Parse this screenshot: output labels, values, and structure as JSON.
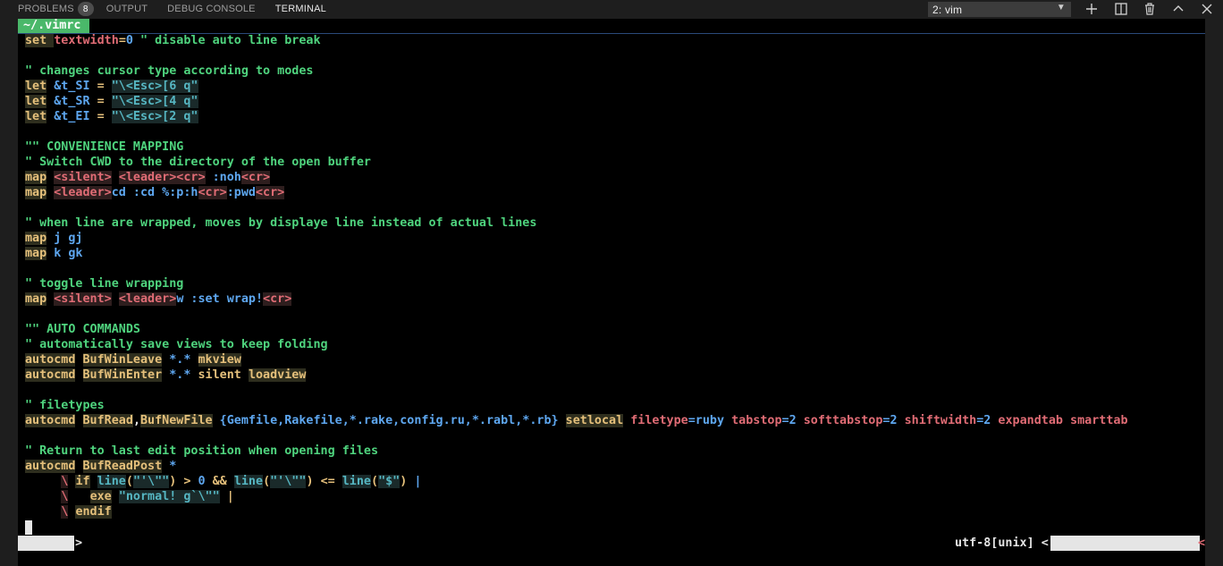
{
  "panel": {
    "tabs": [
      {
        "label": "PROBLEMS",
        "badge": "8"
      },
      {
        "label": "OUTPUT"
      },
      {
        "label": "DEBUG CONSOLE"
      },
      {
        "label": "TERMINAL",
        "active": true
      }
    ],
    "terminal_selector": {
      "value": "2: vim"
    },
    "actions": [
      "plus-icon",
      "split-terminal-icon",
      "trash-icon",
      "chevron-up-icon",
      "close-icon"
    ]
  },
  "vim": {
    "tab_label": "~/.vimrc",
    "lines": [
      [
        {
          "t": "set ",
          "c": "kw"
        },
        {
          "t": "textwidth",
          "c": "var"
        },
        {
          "t": "=",
          "c": "op"
        },
        {
          "t": "0",
          "c": "num"
        },
        {
          "t": " \" disable auto line break",
          "c": "cm"
        }
      ],
      [],
      [
        {
          "t": "\" changes cursor type according to modes",
          "c": "cm"
        }
      ],
      [
        {
          "t": "let",
          "c": "kw"
        },
        {
          "t": " ",
          "c": ""
        },
        {
          "t": "&t_SI",
          "c": "opt"
        },
        {
          "t": " ",
          "c": ""
        },
        {
          "t": "=",
          "c": "op"
        },
        {
          "t": " ",
          "c": ""
        },
        {
          "t": "\"\\<Esc>[6 q\"",
          "c": "str"
        }
      ],
      [
        {
          "t": "let",
          "c": "kw"
        },
        {
          "t": " ",
          "c": ""
        },
        {
          "t": "&t_SR",
          "c": "opt"
        },
        {
          "t": " ",
          "c": ""
        },
        {
          "t": "=",
          "c": "op"
        },
        {
          "t": " ",
          "c": ""
        },
        {
          "t": "\"\\<Esc>[4 q\"",
          "c": "str"
        }
      ],
      [
        {
          "t": "let",
          "c": "kw"
        },
        {
          "t": " ",
          "c": ""
        },
        {
          "t": "&t_EI",
          "c": "opt"
        },
        {
          "t": " ",
          "c": ""
        },
        {
          "t": "=",
          "c": "op"
        },
        {
          "t": " ",
          "c": ""
        },
        {
          "t": "\"\\<Esc>[2 q\"",
          "c": "str"
        }
      ],
      [],
      [
        {
          "t": "\"\" CONVENIENCE MAPPING",
          "c": "cm"
        }
      ],
      [
        {
          "t": "\" Switch CWD to the directory of the open buffer",
          "c": "cm"
        }
      ],
      [
        {
          "t": "map",
          "c": "kw"
        },
        {
          "t": " ",
          "c": ""
        },
        {
          "t": "<silent>",
          "c": "spc"
        },
        {
          "t": " ",
          "c": ""
        },
        {
          "t": "<leader><cr>",
          "c": "spc"
        },
        {
          "t": " :noh",
          "c": "opt"
        },
        {
          "t": "<cr>",
          "c": "spc"
        }
      ],
      [
        {
          "t": "map",
          "c": "kw"
        },
        {
          "t": " ",
          "c": ""
        },
        {
          "t": "<leader>",
          "c": "spc"
        },
        {
          "t": "cd :cd %:p:h",
          "c": "opt"
        },
        {
          "t": "<cr>",
          "c": "spc"
        },
        {
          "t": ":pwd",
          "c": "opt"
        },
        {
          "t": "<cr>",
          "c": "spc"
        }
      ],
      [],
      [
        {
          "t": "\" when line are wrapped, moves by displaye line instead of actual lines",
          "c": "cm"
        }
      ],
      [
        {
          "t": "map",
          "c": "kw"
        },
        {
          "t": " j gj",
          "c": "opt"
        }
      ],
      [
        {
          "t": "map",
          "c": "kw"
        },
        {
          "t": " k gk",
          "c": "opt"
        }
      ],
      [],
      [
        {
          "t": "\" toggle line wrapping",
          "c": "cm"
        }
      ],
      [
        {
          "t": "map",
          "c": "kw"
        },
        {
          "t": " ",
          "c": ""
        },
        {
          "t": "<silent>",
          "c": "spc"
        },
        {
          "t": " ",
          "c": ""
        },
        {
          "t": "<leader>",
          "c": "spc"
        },
        {
          "t": "w :set wrap!",
          "c": "opt"
        },
        {
          "t": "<cr>",
          "c": "spc"
        }
      ],
      [],
      [
        {
          "t": "\"\" AUTO COMMANDS",
          "c": "cm"
        }
      ],
      [
        {
          "t": "\" automatically save views to keep folding",
          "c": "cm"
        }
      ],
      [
        {
          "t": "autocmd",
          "c": "kw"
        },
        {
          "t": " ",
          "c": ""
        },
        {
          "t": "BufWinLeave",
          "c": "kw"
        },
        {
          "t": " *.* ",
          "c": "opt"
        },
        {
          "t": "mkview",
          "c": "kw"
        }
      ],
      [
        {
          "t": "autocmd",
          "c": "kw"
        },
        {
          "t": " ",
          "c": ""
        },
        {
          "t": "BufWinEnter",
          "c": "kw"
        },
        {
          "t": " *.* ",
          "c": "opt"
        },
        {
          "t": "silent",
          "c": "op"
        },
        {
          "t": " ",
          "c": ""
        },
        {
          "t": "loadview",
          "c": "kw"
        }
      ],
      [],
      [
        {
          "t": "\" filetypes",
          "c": "cm"
        }
      ],
      [
        {
          "t": "autocmd",
          "c": "kw"
        },
        {
          "t": " ",
          "c": ""
        },
        {
          "t": "BufRead",
          "c": "kw"
        },
        {
          "t": ",",
          "c": "wht"
        },
        {
          "t": "BufNewFile",
          "c": "kw"
        },
        {
          "t": " {Gemfile,Rakefile,*.rake,config.ru,*.rabl,*.rb} ",
          "c": "opt"
        },
        {
          "t": "setlocal",
          "c": "kw"
        },
        {
          "t": " ",
          "c": ""
        },
        {
          "t": "filetype",
          "c": "var"
        },
        {
          "t": "=ruby ",
          "c": "opt"
        },
        {
          "t": "tabstop",
          "c": "var"
        },
        {
          "t": "=2 ",
          "c": "opt"
        },
        {
          "t": "softtabstop",
          "c": "var"
        },
        {
          "t": "=2 ",
          "c": "opt"
        },
        {
          "t": "shiftwidth",
          "c": "var"
        },
        {
          "t": "=2 ",
          "c": "opt"
        },
        {
          "t": "expandtab",
          "c": "var"
        },
        {
          "t": " ",
          "c": ""
        },
        {
          "t": "smarttab",
          "c": "var"
        }
      ],
      [],
      [
        {
          "t": "\" Return to last edit position when opening files",
          "c": "cm"
        }
      ],
      [
        {
          "t": "autocmd",
          "c": "kw"
        },
        {
          "t": " ",
          "c": ""
        },
        {
          "t": "BufReadPost",
          "c": "kw"
        },
        {
          "t": " *",
          "c": "opt"
        }
      ],
      [
        {
          "t": "     ",
          "c": ""
        },
        {
          "t": "\\",
          "c": "bs"
        },
        {
          "t": " ",
          "c": ""
        },
        {
          "t": "if",
          "c": "kw"
        },
        {
          "t": " ",
          "c": ""
        },
        {
          "t": "line",
          "c": "str"
        },
        {
          "t": "(",
          "c": "op"
        },
        {
          "t": "\"'\\\"\"",
          "c": "str"
        },
        {
          "t": ")",
          "c": "op"
        },
        {
          "t": " ",
          "c": ""
        },
        {
          "t": ">",
          "c": "op"
        },
        {
          "t": " 0 ",
          "c": "num"
        },
        {
          "t": "&&",
          "c": "op"
        },
        {
          "t": " ",
          "c": ""
        },
        {
          "t": "line",
          "c": "str"
        },
        {
          "t": "(",
          "c": "op"
        },
        {
          "t": "\"'\\\"\"",
          "c": "str"
        },
        {
          "t": ")",
          "c": "op"
        },
        {
          "t": " ",
          "c": ""
        },
        {
          "t": "<=",
          "c": "op"
        },
        {
          "t": " ",
          "c": ""
        },
        {
          "t": "line",
          "c": "str"
        },
        {
          "t": "(",
          "c": "op"
        },
        {
          "t": "\"$\"",
          "c": "str"
        },
        {
          "t": ")",
          "c": "op"
        },
        {
          "t": " ",
          "c": ""
        },
        {
          "t": "|",
          "c": "opt"
        }
      ],
      [
        {
          "t": "     ",
          "c": ""
        },
        {
          "t": "\\",
          "c": "bs"
        },
        {
          "t": "   ",
          "c": ""
        },
        {
          "t": "exe",
          "c": "kw"
        },
        {
          "t": " ",
          "c": ""
        },
        {
          "t": "\"normal! g`\\\"\"",
          "c": "str"
        },
        {
          "t": " ",
          "c": ""
        },
        {
          "t": "|",
          "c": "op"
        }
      ],
      [
        {
          "t": "     ",
          "c": ""
        },
        {
          "t": "\\",
          "c": "bs"
        },
        {
          "t": " ",
          "c": ""
        },
        {
          "t": "endif",
          "c": "kw"
        }
      ]
    ],
    "status": {
      "left_arrow": ">",
      "encoding": "utf-8[unix] <",
      "right_arrow": "<"
    }
  },
  "colors": {
    "accent_tab": "#4ab86a",
    "comment": "#4fd47e",
    "keyword": "#e5c07b",
    "variable": "#e06c75",
    "option": "#5ea7f0"
  }
}
